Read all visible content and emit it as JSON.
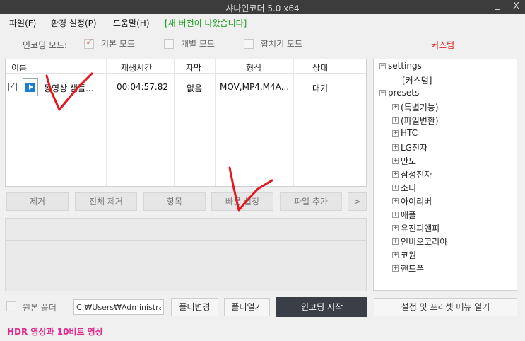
{
  "window": {
    "title": "샤나인코더 5.0 x64",
    "min_symbol": "_",
    "close_symbol": "X"
  },
  "menu": {
    "items": [
      "파일(F)",
      "환경 설정(P)",
      "도움말(H)"
    ],
    "notice": "[새 버전이 나왔습니다]"
  },
  "modes": {
    "label": "인코딩 모드:",
    "options": [
      {
        "label": "기본 모드",
        "checked": true
      },
      {
        "label": "개별 모드",
        "checked": false
      },
      {
        "label": "합치기 모드",
        "checked": false
      }
    ],
    "custom": "커스텀"
  },
  "filelist": {
    "columns": [
      "이름",
      "재생시간",
      "자막",
      "형식",
      "상태"
    ],
    "rows": [
      {
        "checked": true,
        "name": "동영상 샘플...",
        "duration": "00:04:57.82",
        "subtitle": "없음",
        "format": "MOV,MP4,M4A...",
        "status": "대기"
      }
    ]
  },
  "buttons": {
    "remove": "제거",
    "remove_all": "전체 제거",
    "item": "항목",
    "quick_settings": "빠른 설정",
    "add_file": "파일 추가",
    "more": ">"
  },
  "tree": {
    "nodes": [
      {
        "label": "settings",
        "level": 0,
        "expander": "−"
      },
      {
        "label": "[커스텀]",
        "level": 1,
        "expander": ""
      },
      {
        "label": "presets",
        "level": 0,
        "expander": "−"
      },
      {
        "label": "(특별기능)",
        "level": 1,
        "expander": "+"
      },
      {
        "label": "(파일변환)",
        "level": 1,
        "expander": "+"
      },
      {
        "label": "HTC",
        "level": 1,
        "expander": "+"
      },
      {
        "label": "LG전자",
        "level": 1,
        "expander": "+"
      },
      {
        "label": "만도",
        "level": 1,
        "expander": "+"
      },
      {
        "label": "삼성전자",
        "level": 1,
        "expander": "+"
      },
      {
        "label": "소니",
        "level": 1,
        "expander": "+"
      },
      {
        "label": "아이리버",
        "level": 1,
        "expander": "+"
      },
      {
        "label": "애플",
        "level": 1,
        "expander": "+"
      },
      {
        "label": "유진피앤피",
        "level": 1,
        "expander": "+"
      },
      {
        "label": "인비오코리아",
        "level": 1,
        "expander": "+"
      },
      {
        "label": "코원",
        "level": 1,
        "expander": "+"
      },
      {
        "label": "핸드폰",
        "level": 1,
        "expander": "+"
      }
    ]
  },
  "bottom": {
    "original_folder_label": "원본 폴더",
    "path": "C:₩Users₩Administrator",
    "change_folder": "폴더변경",
    "open_folder": "폴더열기",
    "start_encoding": "인코딩 시작",
    "settings_menu": "설정 및 프리셋 메뉴 열기"
  },
  "status": {
    "text": "HDR 영상과 10비트 영상"
  },
  "colors": {
    "titlebar": "#3c3c3c",
    "notice": "#1a9e1a",
    "custom": "#e02020",
    "status": "#e0288c",
    "start_button": "#3a3f47",
    "annotation": "#e8141e"
  }
}
